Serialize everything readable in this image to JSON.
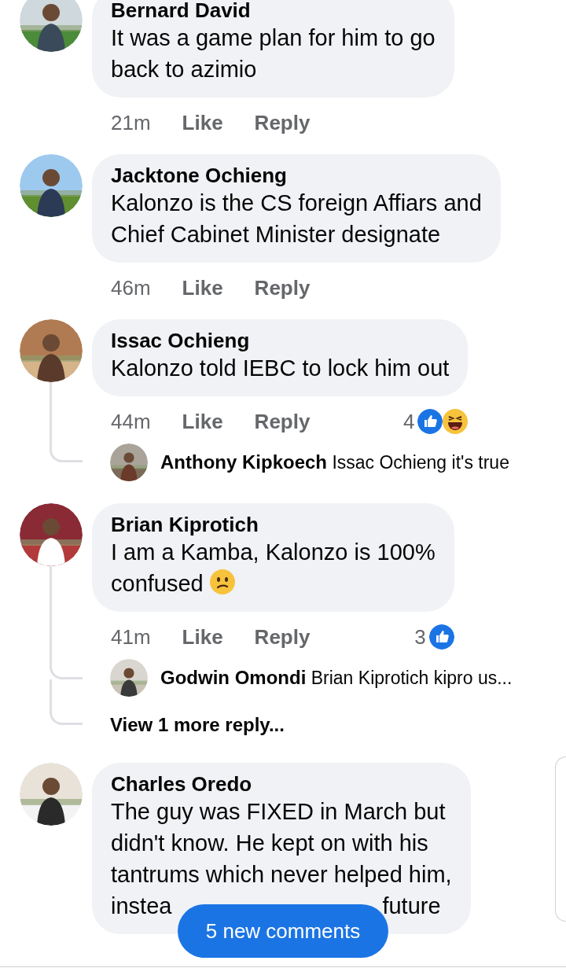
{
  "comments": [
    {
      "name": "Bernard David",
      "lines": [
        [
          "It was a game plan for  him to go"
        ],
        [
          "back to azimio"
        ]
      ],
      "time": "21m",
      "like": "Like",
      "reply": "Reply"
    },
    {
      "name": "Jacktone Ochieng",
      "lines": [
        [
          "Kalonzo is the CS foreign Affiars and"
        ],
        [
          "Chief Cabinet Minister designate"
        ]
      ],
      "time": "46m",
      "like": "Like",
      "reply": "Reply"
    },
    {
      "name": "Issac Ochieng",
      "lines": [
        [
          "Kalonzo told IEBC to lock him out"
        ]
      ],
      "time": "44m",
      "like": "Like",
      "reply": "Reply",
      "reactions": {
        "count": "4",
        "icons": [
          {
            "kind": "like"
          },
          {
            "kind": "haha"
          }
        ]
      },
      "replies": [
        {
          "kind": "reply",
          "name": "Anthony Kipkoech",
          "text": "Issac Ochieng it's true"
        }
      ]
    },
    {
      "name": "Brian Kiprotich",
      "lines": [
        [
          "I am a Kamba, Kalonzo is 100%"
        ],
        [
          "confused"
        ]
      ],
      "emoji": {
        "kind": "confused"
      },
      "time": "41m",
      "like": "Like",
      "reply": "Reply",
      "reactions": {
        "count": "3",
        "icons": [
          {
            "kind": "like"
          }
        ]
      },
      "replies": [
        {
          "kind": "reply",
          "name": "Godwin Omondi",
          "text": "Brian Kiprotich kipro us..."
        },
        {
          "kind": "more",
          "text": "View 1 more reply..."
        }
      ]
    },
    {
      "name": "Charles Oredo",
      "lines": [
        [
          "The guy was FIXED in March but"
        ],
        [
          "didn't know. He kept on with his"
        ],
        [
          "tantrums which never helped him,"
        ],
        [
          "instea",
          "future"
        ]
      ]
    }
  ],
  "new_comments_button": "5 new comments"
}
